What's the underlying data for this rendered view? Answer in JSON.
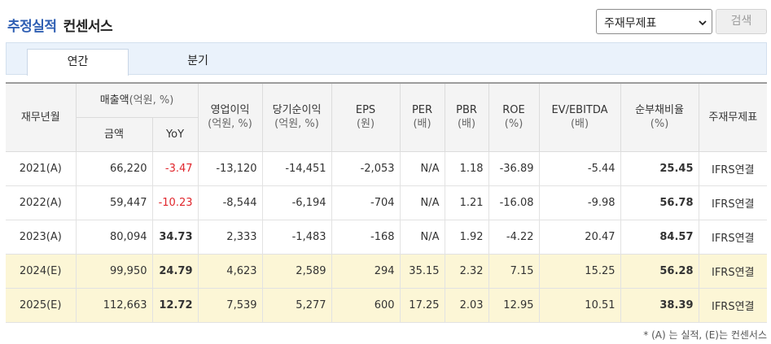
{
  "header": {
    "title_part1": "추정실적",
    "title_part2": "컨센서스",
    "select_value": "주재무제표",
    "search_label": "검색"
  },
  "tabs": [
    {
      "label": "연간",
      "active": true
    },
    {
      "label": "분기",
      "active": false
    }
  ],
  "table": {
    "headers": {
      "period": "재무년월",
      "sales_group": "매출액",
      "sales_group_unit": "(억원, %)",
      "sales_amount": "금액",
      "sales_yoy": "YoY",
      "op_income": "영업이익",
      "op_income_unit": "(억원, %)",
      "net_income": "당기순이익",
      "net_income_unit": "(억원, %)",
      "eps": "EPS",
      "eps_unit": "(원)",
      "per": "PER",
      "per_unit": "(배)",
      "pbr": "PBR",
      "pbr_unit": "(배)",
      "roe": "ROE",
      "roe_unit": "(%)",
      "ev_ebitda": "EV/EBITDA",
      "ev_ebitda_unit": "(배)",
      "debt_ratio": "순부채비율",
      "debt_ratio_unit": "(%)",
      "statement": "주재무제표"
    },
    "rows": [
      {
        "period": "2021(A)",
        "sales": "66,220",
        "yoy": "-3.47",
        "op": "-13,120",
        "net": "-14,451",
        "eps": "-2,053",
        "per": "N/A",
        "pbr": "1.18",
        "roe": "-36.89",
        "ev": "-5.44",
        "debt": "25.45",
        "stmt": "IFRS연결"
      },
      {
        "period": "2022(A)",
        "sales": "59,447",
        "yoy": "-10.23",
        "op": "-8,544",
        "net": "-6,194",
        "eps": "-704",
        "per": "N/A",
        "pbr": "1.21",
        "roe": "-16.08",
        "ev": "-9.98",
        "debt": "56.78",
        "stmt": "IFRS연결"
      },
      {
        "period": "2023(A)",
        "sales": "80,094",
        "yoy": "34.73",
        "op": "2,333",
        "net": "-1,483",
        "eps": "-168",
        "per": "N/A",
        "pbr": "1.92",
        "roe": "-4.22",
        "ev": "20.47",
        "debt": "84.57",
        "stmt": "IFRS연결"
      },
      {
        "period": "2024(E)",
        "sales": "99,950",
        "yoy": "24.79",
        "op": "4,623",
        "net": "2,589",
        "eps": "294",
        "per": "35.15",
        "pbr": "2.32",
        "roe": "7.15",
        "ev": "15.25",
        "debt": "56.28",
        "stmt": "IFRS연결"
      },
      {
        "period": "2025(E)",
        "sales": "112,663",
        "yoy": "12.72",
        "op": "7,539",
        "net": "5,277",
        "eps": "600",
        "per": "17.25",
        "pbr": "2.03",
        "roe": "12.95",
        "ev": "10.51",
        "debt": "38.39",
        "stmt": "IFRS연결"
      }
    ]
  },
  "footnote": "* (A) 는 실적, (E)는 컨센서스",
  "colors": {
    "title_blue": "#2f5fb3",
    "negative_red": "#e0262c",
    "estimate_row_bg": "#fcf6d6"
  }
}
